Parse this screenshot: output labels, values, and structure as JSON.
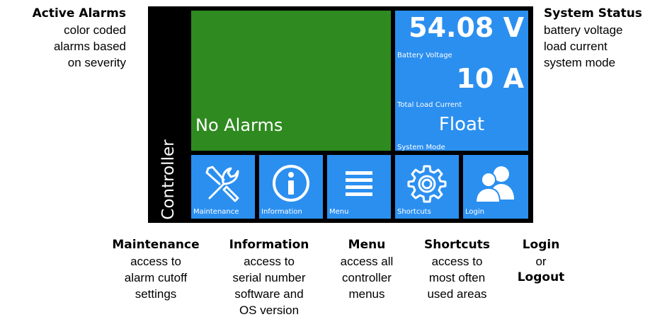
{
  "callouts": {
    "active_alarms": {
      "title": "Active Alarms",
      "lines": [
        "color coded",
        "alarms based",
        "on severity"
      ]
    },
    "system_status": {
      "title": "System Status",
      "lines": [
        "battery voltage",
        "load current",
        "system mode"
      ]
    },
    "maintenance": {
      "title": "Maintenance",
      "lines": [
        "access to",
        "alarm cutoff",
        "settings"
      ]
    },
    "information": {
      "title": "Information",
      "lines": [
        "access to",
        "serial number",
        "software and",
        "OS version"
      ]
    },
    "menu": {
      "title": "Menu",
      "lines": [
        "access all",
        "controller",
        "menus"
      ]
    },
    "shortcuts": {
      "title": "Shortcuts",
      "lines": [
        "access to",
        "most often",
        "used areas"
      ]
    },
    "login": {
      "title": "Login",
      "middle": "or",
      "title2": "Logout"
    }
  },
  "screen": {
    "side_label": "Controller",
    "alarm_text": "No Alarms",
    "battery_voltage_value": "54.08 V",
    "battery_voltage_label": "Battery Voltage",
    "load_current_value": "10 A",
    "load_current_label": "Total Load Current",
    "system_mode_value": "Float",
    "system_mode_label": "System Mode",
    "tiles": [
      {
        "label": "Maintenance",
        "icon": "wrench-screwdriver-icon"
      },
      {
        "label": "Information",
        "icon": "info-icon"
      },
      {
        "label": "Menu",
        "icon": "hamburger-menu-icon"
      },
      {
        "label": "Shortcuts",
        "icon": "gear-icon"
      },
      {
        "label": "Login",
        "icon": "users-icon"
      }
    ]
  },
  "colors": {
    "alarm_green": "#2f8a20",
    "tile_blue": "#2b8ff0",
    "screen_black": "#000000"
  }
}
